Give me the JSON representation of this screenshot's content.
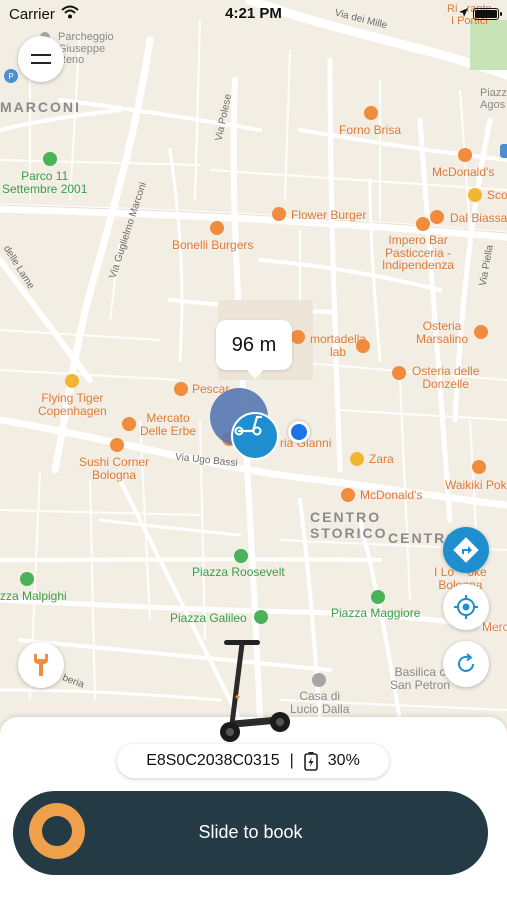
{
  "status_bar": {
    "carrier": "Carrier",
    "time": "4:21 PM"
  },
  "map": {
    "streets": [
      "Via dei Mille",
      "Via Guglielmo Marconi",
      "Via Polese",
      "Via Ugo Bassi",
      "Via Piella",
      "delle Lame",
      "beria"
    ],
    "districts": [
      "MARCONI",
      "CENTRO STORICO",
      "CENTRO"
    ],
    "places": {
      "porcheggio": "Parcheggio\nGiuseppe\nReno",
      "parco": "Parco 11\nSettembre 2001",
      "forno_brisa": "Forno Brisa",
      "flower_burger": "Flower Burger",
      "bonelli": "Bonelli Burgers",
      "mortadella": "mortadella\nlab",
      "pescar": "Pescar",
      "osteria_marsalino": "Osteria\nMarsalino",
      "osteria_donzelle": "Osteria delle\nDonzelle",
      "flying_tiger": "Flying Tiger\nCopenhagen",
      "mercato": "Mercato\nDelle Erbe",
      "sushi": "Sushi Corner\nBologna",
      "gianni": "ria Gianni",
      "zara": "Zara",
      "mcdonalds1": "McDonald's",
      "mcdonalds2": "McDonald's",
      "impero": "Impero Bar\nPasticceria -\nIndipendenza",
      "dal_biassa": "Dal Biassa",
      "waikiki": "Waikiki Pok",
      "roosevelt": "Piazza Roosevelt",
      "galileo": "Piazza Galileo",
      "maggiore": "Piazza Maggiore",
      "malpighi": "zza Malpighi",
      "lucio": "Casa di\nLucio Dalla",
      "basilica": "Basilica c\nSan Petron",
      "portici": "Ri   rante\nI Portici",
      "piazza_agos": "Piazza\nAgos",
      "sco": "Sco",
      "merc": "Merc",
      "lo_poke": "I Lo    oke\nBologna"
    }
  },
  "tooltip": {
    "distance": "96 m"
  },
  "vehicle": {
    "id": "E8S0C2038C0315",
    "separator": "|",
    "battery": "30%"
  },
  "slider": {
    "label": "Slide to book"
  },
  "icons": {
    "menu": "hamburger-icon",
    "wrench": "wrench-icon",
    "directions": "directions-icon",
    "locate": "locate-icon",
    "refresh": "refresh-icon",
    "scooter": "scooter-icon",
    "battery": "battery-charging-icon"
  },
  "colors": {
    "accent": "#1f8ecf",
    "slider_bg": "#243a44",
    "knob": "#f0a04a",
    "wrench": "#f08c3c",
    "marker_cluster": "#5577b0"
  }
}
